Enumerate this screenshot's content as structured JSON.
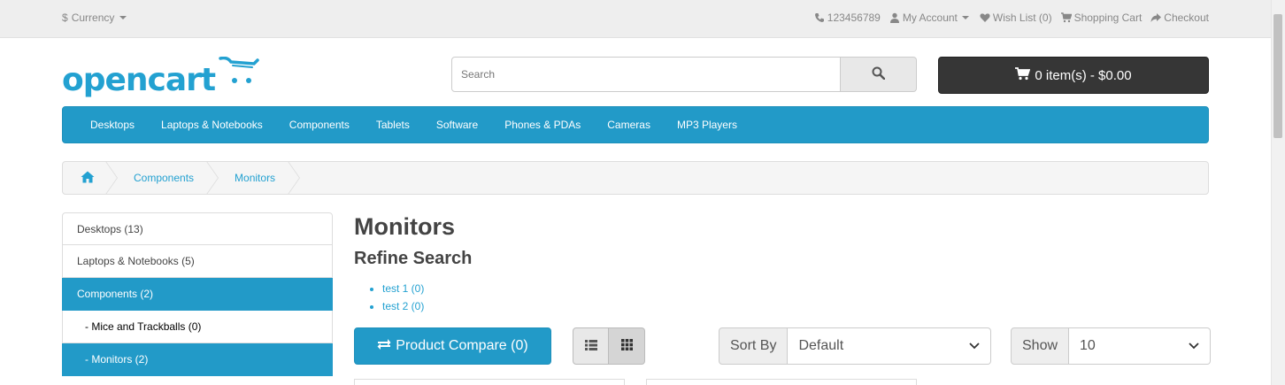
{
  "topbar": {
    "currency_label": "Currency",
    "currency_symbol": "$",
    "phone": "123456789",
    "my_account": "My Account",
    "wish_list": "Wish List (0)",
    "shopping_cart": "Shopping Cart",
    "checkout": "Checkout"
  },
  "header": {
    "logo_text": "opencart",
    "search_placeholder": "Search",
    "cart_button": "0 item(s) - $0.00"
  },
  "menu": {
    "items": [
      "Desktops",
      "Laptops & Notebooks",
      "Components",
      "Tablets",
      "Software",
      "Phones & PDAs",
      "Cameras",
      "MP3 Players"
    ]
  },
  "breadcrumb": {
    "items": [
      "Components",
      "Monitors"
    ]
  },
  "sidebar": {
    "items": [
      {
        "label": "Desktops (13)"
      },
      {
        "label": "Laptops & Notebooks (5)"
      },
      {
        "label": "Components (2)"
      },
      {
        "label": "- Mice and Trackballs (0)"
      },
      {
        "label": "- Monitors (2)"
      }
    ]
  },
  "main": {
    "title": "Monitors",
    "refine_title": "Refine Search",
    "refine_links": [
      "test 1 (0)",
      "test 2 (0)"
    ],
    "compare_button": "Product Compare (0)",
    "sort_label": "Sort By",
    "sort_value": "Default",
    "show_label": "Show",
    "show_value": "10"
  },
  "colors": {
    "accent": "#229ac8",
    "link": "#23a1d1",
    "cart_dark": "#363636"
  }
}
